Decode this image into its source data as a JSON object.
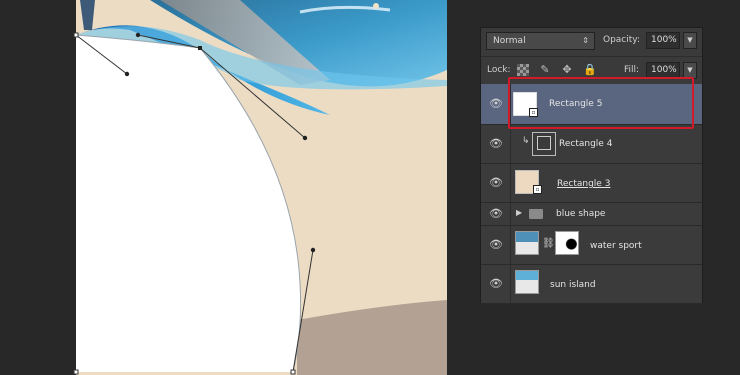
{
  "layers_panel": {
    "blend_mode": "Normal",
    "opacity_label": "Opacity:",
    "opacity_value": "100%",
    "lock_label": "Lock:",
    "fill_label": "Fill:",
    "fill_value": "100%",
    "layers": [
      {
        "name": "Rectangle 5",
        "selected": true,
        "visible": true
      },
      {
        "name": "Rectangle 4",
        "selected": false,
        "visible": true,
        "clipped": true
      },
      {
        "name": "Rectangle 3",
        "selected": false,
        "visible": true
      },
      {
        "name": "blue shape",
        "selected": false,
        "visible": true,
        "type": "group"
      },
      {
        "name": "water sport",
        "selected": false,
        "visible": true,
        "has_mask": true
      },
      {
        "name": "sun island",
        "selected": false,
        "visible": true
      }
    ]
  },
  "colors": {
    "background": "#282828",
    "canvas_beige": "#ecdcc4",
    "canvas_brown": "#b3a193",
    "blue_shape": "#1e88c8",
    "highlight": "#d21a2a",
    "selected_row": "#5a6680"
  },
  "icons": {
    "blend_arrows": "updown-arrows-icon",
    "eye": "eye-icon",
    "lock_transparent": "checkerboard-lock-icon",
    "lock_brush": "brush-lock-icon",
    "lock_move": "move-cross-icon",
    "lock_all": "padlock-icon",
    "folder": "folder-icon",
    "expand": "triangle-right-icon",
    "clip": "clip-arrow-icon",
    "link": "chain-link-icon"
  }
}
